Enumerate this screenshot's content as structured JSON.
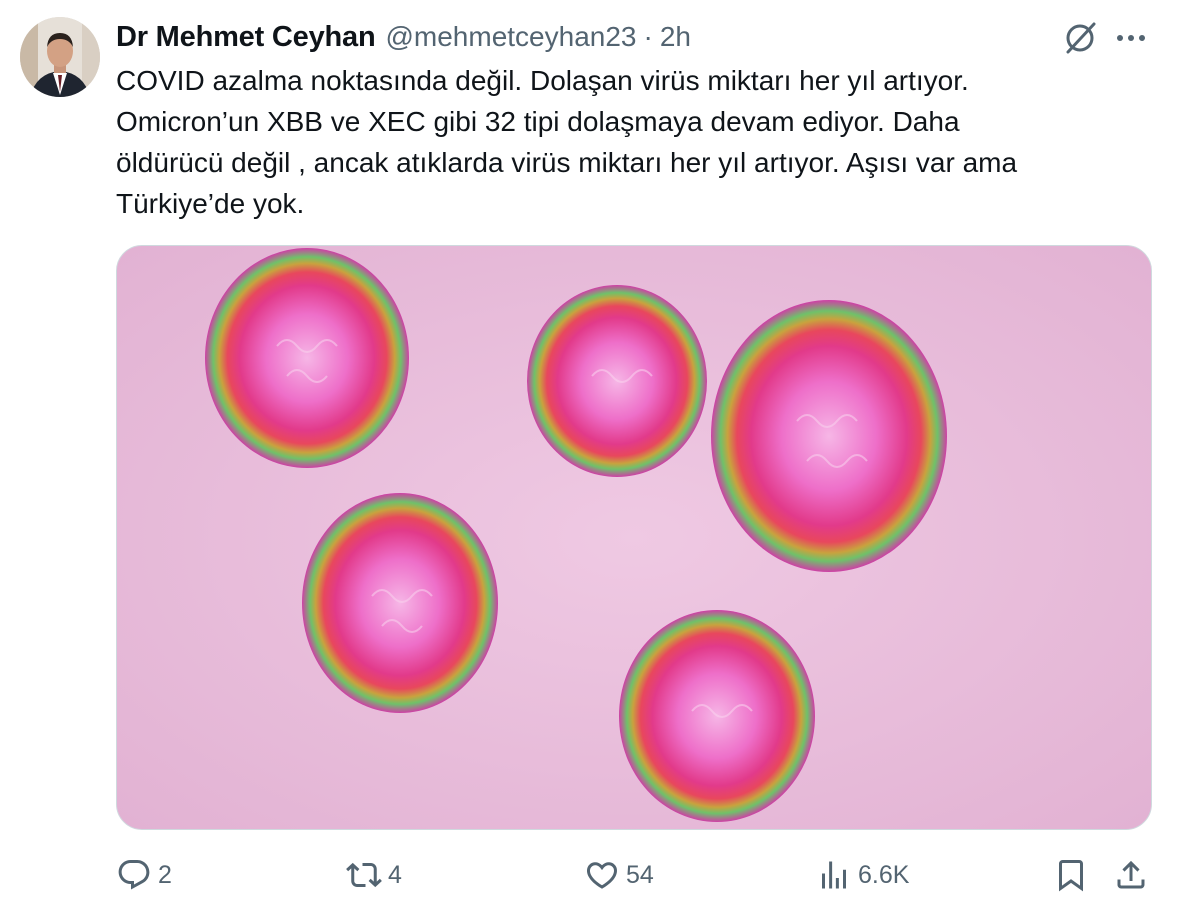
{
  "author": {
    "name": "Dr Mehmet Ceyhan",
    "handle": "@mehmetceyhan23",
    "separator": "·",
    "time": "2h"
  },
  "tweet": {
    "lines": [
      "COVID azalma noktasında değil. Dolaşan virüs miktarı her yıl artıyor.",
      "Omicron’un XBB ve XEC gibi 32 tipi dolaşmaya devam ediyor. Daha",
      "öldürücü değil , ancak atıklarda virüs miktarı her yıl artıyor. Aşısı var ama",
      "Türkiye’de yok."
    ]
  },
  "actions": {
    "replies": "2",
    "reposts": "4",
    "likes": "54",
    "views": "6.6K"
  },
  "icons": {
    "reply": "reply-icon",
    "repost": "repost-icon",
    "like": "heart-icon",
    "views": "views-icon",
    "bookmark": "bookmark-icon",
    "share": "share-icon",
    "grok": "grok-icon",
    "more": "more-icon"
  },
  "colors": {
    "text_primary": "#0f1419",
    "text_secondary": "#536471",
    "media_background": "#e8bcdb"
  }
}
